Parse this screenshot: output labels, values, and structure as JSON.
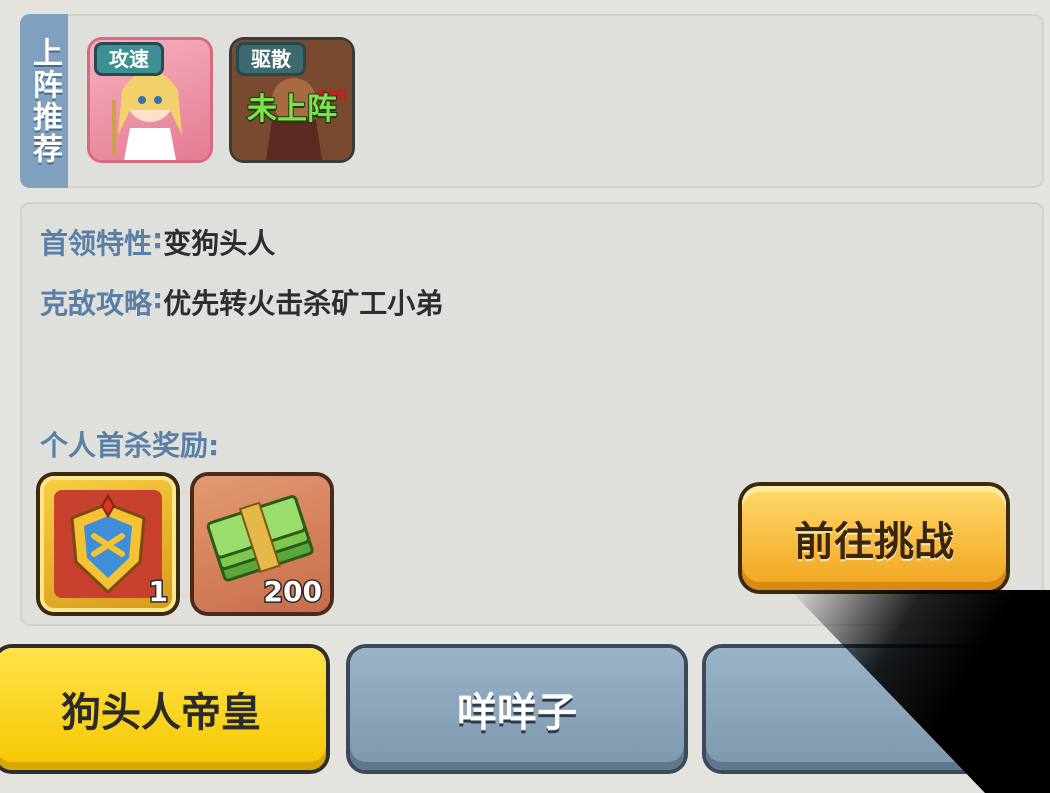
{
  "recommend": {
    "label": "上阵推荐",
    "heroes": [
      {
        "tag": "攻速",
        "status": ""
      },
      {
        "tag": "驱散",
        "status": "未上阵"
      }
    ]
  },
  "boss_info": {
    "trait_label": "首领特性",
    "trait_value": "变狗头人",
    "strategy_label": "克敌攻略",
    "strategy_value": "优先转火击杀矿工小弟",
    "colon": ":",
    "reward_title": "个人首杀奖励:",
    "rewards": [
      {
        "icon": "shield-badge-icon",
        "count": "1"
      },
      {
        "icon": "cash-stack-icon",
        "count": "200"
      }
    ]
  },
  "challenge_button": "前往挑战",
  "boss_tabs": [
    {
      "label": "狗头人帝皇",
      "active": true
    },
    {
      "label": "咩咩子",
      "active": false
    },
    {
      "label": "",
      "active": false
    }
  ],
  "colors": {
    "accent_blue": "#5a7fa6",
    "tab_active": "#f5c700",
    "button_orange": "#f2a41f"
  }
}
